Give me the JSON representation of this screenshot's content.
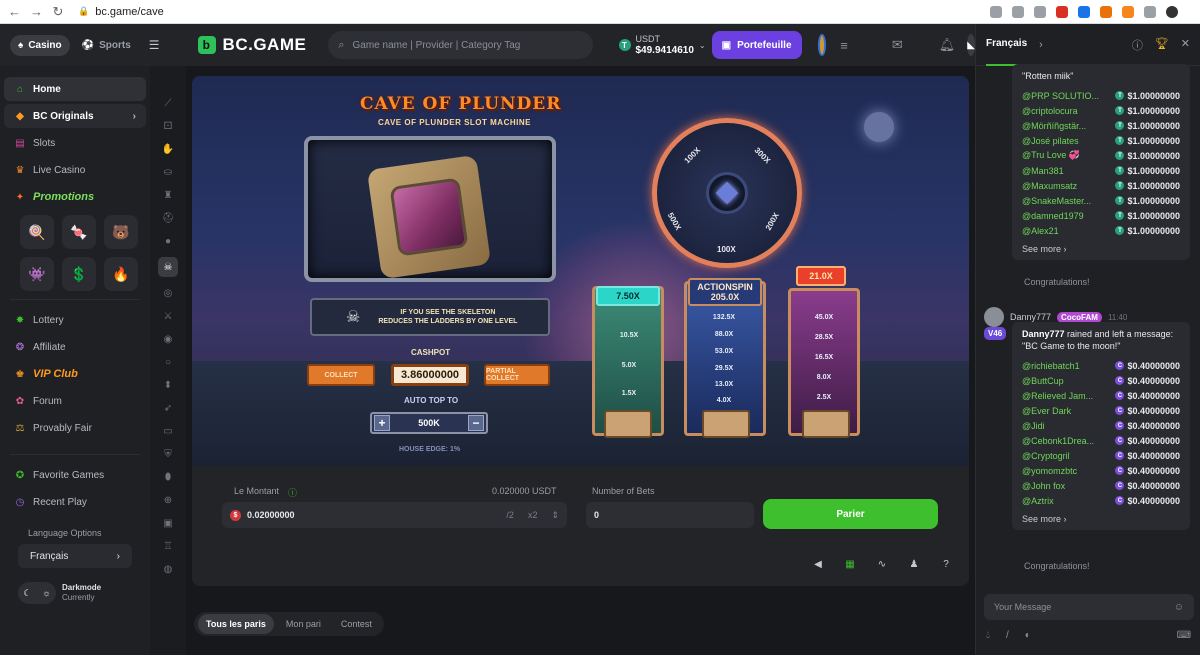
{
  "browser": {
    "url": "bc.game/cave",
    "back": "←",
    "forward": "→",
    "reload": "↻"
  },
  "header": {
    "modes": [
      {
        "label": "Casino",
        "icon": "spade-icon"
      },
      {
        "label": "Sports",
        "icon": "ball-icon"
      }
    ],
    "logo": "BC.GAME",
    "search_placeholder": "Game name | Provider | Category Tag",
    "balance_currency": "USDT",
    "balance_amount": "$49.9414610",
    "wallet_label": "Portefeuille"
  },
  "sidebar": {
    "home": "Home",
    "originals": "BC Originals",
    "slots": "Slots",
    "live_casino": "Live Casino",
    "promotions": "Promotions",
    "promo_icons": [
      "🍭",
      "🍬",
      "🐻",
      "👾",
      "💲",
      "🔥"
    ],
    "lottery": "Lottery",
    "affiliate": "Affiliate",
    "vip": "VIP Club",
    "forum": "Forum",
    "provably_fair": "Provably Fair",
    "favorite": "Favorite Games",
    "recent": "Recent Play",
    "language_label": "Language Options",
    "language_value": "Français",
    "darkmode_title": "Darkmode",
    "darkmode_sub": "Currently"
  },
  "game": {
    "title": "CAVE OF PLUNDER",
    "subtitle": "CAVE OF PLUNDER SLOT MACHINE",
    "skeleton_line1": "IF YOU SEE THE SKELETON",
    "skeleton_line2": "REDUCES THE LADDERS BY ONE LEVEL",
    "cashpot_label": "CASHPOT",
    "collect_label": "COLLECT",
    "cashpot_value": "3.86000000",
    "partial_collect_label": "PARTIAL COLLECT",
    "auto_top_label": "AUTO TOP TO",
    "auto_top_value": "500K",
    "house_edge": "HOUSE EDGE: 1%",
    "wheel_labels": [
      "100X",
      "300X",
      "200X",
      "100X",
      "500X"
    ],
    "ladder_green": {
      "top": "7.50X",
      "rungs": [
        "10.5X",
        "5.0X",
        "1.5X"
      ]
    },
    "ladder_blue": {
      "top_title": "ACTIONSPIN",
      "top_value": "205.0X",
      "rungs": [
        "132.5X",
        "88.0X",
        "53.0X",
        "29.5X",
        "13.0X",
        "4.0X"
      ]
    },
    "ladder_purple": {
      "top": "21.0X",
      "rungs": [
        "45.0X",
        "28.5X",
        "16.5X",
        "8.0X",
        "2.5X"
      ]
    }
  },
  "bet_panel": {
    "amount_label": "Le Montant",
    "amount_usd": "0.020000 USDT",
    "amount_value": "0.02000000",
    "half": "/2",
    "double": "x2",
    "bets_label": "Number of Bets",
    "bets_value": "0",
    "bet_button": "Parier"
  },
  "bottom_tabs": [
    "Tous les paris",
    "Mon pari",
    "Contest"
  ],
  "chat": {
    "language": "Français",
    "rain1_header": "\"Rotten miik\"",
    "rain1": [
      {
        "user": "@PRP SOLUTIO...",
        "amount": "$1.00000000"
      },
      {
        "user": "@criptolocura",
        "amount": "$1.00000000"
      },
      {
        "user": "@Mörñíñgstär...",
        "amount": "$1.00000000"
      },
      {
        "user": "@José pilates",
        "amount": "$1.00000000"
      },
      {
        "user": "@Tru Love 💞",
        "amount": "$1.00000000"
      },
      {
        "user": "@Man381",
        "amount": "$1.00000000"
      },
      {
        "user": "@Maxumsatz",
        "amount": "$1.00000000"
      },
      {
        "user": "@SnakeMaster...",
        "amount": "$1.00000000"
      },
      {
        "user": "@damned1979",
        "amount": "$1.00000000"
      },
      {
        "user": "@Alex21",
        "amount": "$1.00000000"
      }
    ],
    "see_more": "See more",
    "congrats": "Congratulations!",
    "msg_name": "Danny777",
    "msg_badge": "CocoFAM",
    "msg_time": "11:40",
    "vip_badge": "V46",
    "rain2_intro_name": "Danny777",
    "rain2_intro_text": " rained and left a message: \"BC Game to the moon!\"",
    "rain2": [
      {
        "user": "@richiebatch1",
        "amount": "$0.40000000"
      },
      {
        "user": "@ButtCup",
        "amount": "$0.40000000"
      },
      {
        "user": "@Relieved Jam...",
        "amount": "$0.40000000"
      },
      {
        "user": "@Ever Dark",
        "amount": "$0.40000000"
      },
      {
        "user": "@Jidi",
        "amount": "$0.40000000"
      },
      {
        "user": "@Cebonk1Drea...",
        "amount": "$0.40000000"
      },
      {
        "user": "@Cryptogril",
        "amount": "$0.40000000"
      },
      {
        "user": "@yomomzbtc",
        "amount": "$0.40000000"
      },
      {
        "user": "@John fox",
        "amount": "$0.40000000"
      },
      {
        "user": "@Aztrix",
        "amount": "$0.40000000"
      }
    ],
    "input_placeholder": "Your Message"
  },
  "colors": {
    "accent": "#3dbf2e",
    "wallet": "#6b3fe0",
    "usdt": "#26a17b",
    "coin": "#7b4ee0"
  }
}
